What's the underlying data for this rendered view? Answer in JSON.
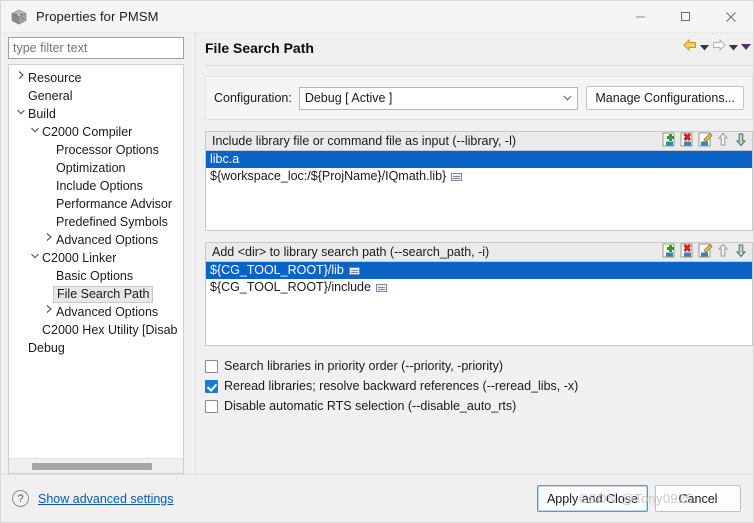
{
  "window": {
    "title": "Properties for PMSM",
    "app_icon": "cube-icon",
    "controls": {
      "minimize": "—",
      "maximize": "☐",
      "close": "✕"
    }
  },
  "filter": {
    "placeholder": "type filter text",
    "value": ""
  },
  "tree": {
    "items": [
      {
        "label": "Resource",
        "depth": 0,
        "twisty": "collapsed",
        "selected": false
      },
      {
        "label": "General",
        "depth": 0,
        "twisty": "none",
        "selected": false
      },
      {
        "label": "Build",
        "depth": 0,
        "twisty": "expanded",
        "selected": false
      },
      {
        "label": "C2000 Compiler",
        "depth": 1,
        "twisty": "expanded",
        "selected": false
      },
      {
        "label": "Processor Options",
        "depth": 2,
        "twisty": "none",
        "selected": false
      },
      {
        "label": "Optimization",
        "depth": 2,
        "twisty": "none",
        "selected": false
      },
      {
        "label": "Include Options",
        "depth": 2,
        "twisty": "none",
        "selected": false
      },
      {
        "label": "Performance Advisor",
        "depth": 2,
        "twisty": "none",
        "selected": false
      },
      {
        "label": "Predefined Symbols",
        "depth": 2,
        "twisty": "none",
        "selected": false
      },
      {
        "label": "Advanced Options",
        "depth": 2,
        "twisty": "collapsed",
        "selected": false
      },
      {
        "label": "C2000 Linker",
        "depth": 1,
        "twisty": "expanded",
        "selected": false
      },
      {
        "label": "Basic Options",
        "depth": 2,
        "twisty": "none",
        "selected": false
      },
      {
        "label": "File Search Path",
        "depth": 2,
        "twisty": "none",
        "selected": true
      },
      {
        "label": "Advanced Options",
        "depth": 2,
        "twisty": "collapsed",
        "selected": false
      },
      {
        "label": "C2000 Hex Utility  [Disab",
        "depth": 1,
        "twisty": "none",
        "selected": false
      },
      {
        "label": "Debug",
        "depth": 0,
        "twisty": "none",
        "selected": false
      }
    ]
  },
  "page": {
    "title": "File Search Path",
    "nav": {
      "back": "back-arrow-icon",
      "back_menu": "chevron-down-icon",
      "forward": "forward-arrow-icon",
      "forward_menu": "chevron-down-icon",
      "overflow_menu": "chevron-down-icon"
    }
  },
  "configuration": {
    "label": "Configuration:",
    "value": "Debug  [ Active ]",
    "manage_button": "Manage Configurations..."
  },
  "lists": [
    {
      "header": "Include library file or command file as input (--library, -l)",
      "tools": [
        "add-icon",
        "delete-icon",
        "edit-icon",
        "move-up-icon",
        "move-down-icon"
      ],
      "rows": [
        {
          "text": "libc.a",
          "selected": true,
          "variable": false
        },
        {
          "text": "${workspace_loc:/${ProjName}/IQmath.lib}",
          "selected": false,
          "variable": true
        }
      ]
    },
    {
      "header": "Add <dir> to library search path (--search_path, -i)",
      "tools": [
        "add-icon",
        "delete-icon",
        "edit-icon",
        "move-up-icon",
        "move-down-icon"
      ],
      "rows": [
        {
          "text": "${CG_TOOL_ROOT}/lib",
          "selected": true,
          "variable": true
        },
        {
          "text": "${CG_TOOL_ROOT}/include",
          "selected": false,
          "variable": true
        }
      ]
    }
  ],
  "checkboxes": [
    {
      "label": "Search libraries in priority order (--priority, -priority)",
      "checked": false
    },
    {
      "label": "Reread libraries; resolve backward references (--reread_libs, -x)",
      "checked": true
    },
    {
      "label": "Disable automatic RTS selection (--disable_auto_rts)",
      "checked": false
    }
  ],
  "footer": {
    "help_icon": "question-mark-icon",
    "advanced_link": "Show advanced settings",
    "apply_button": "Apply and Close",
    "cancel_button": "Cancel"
  },
  "watermark": {
    "text": "CSDN @Tony0925"
  },
  "colors": {
    "selection": "#0a64c8",
    "link": "#0a59b0",
    "checkbox_on": "#1a7bd4",
    "header_bg": "#eaeaea"
  }
}
